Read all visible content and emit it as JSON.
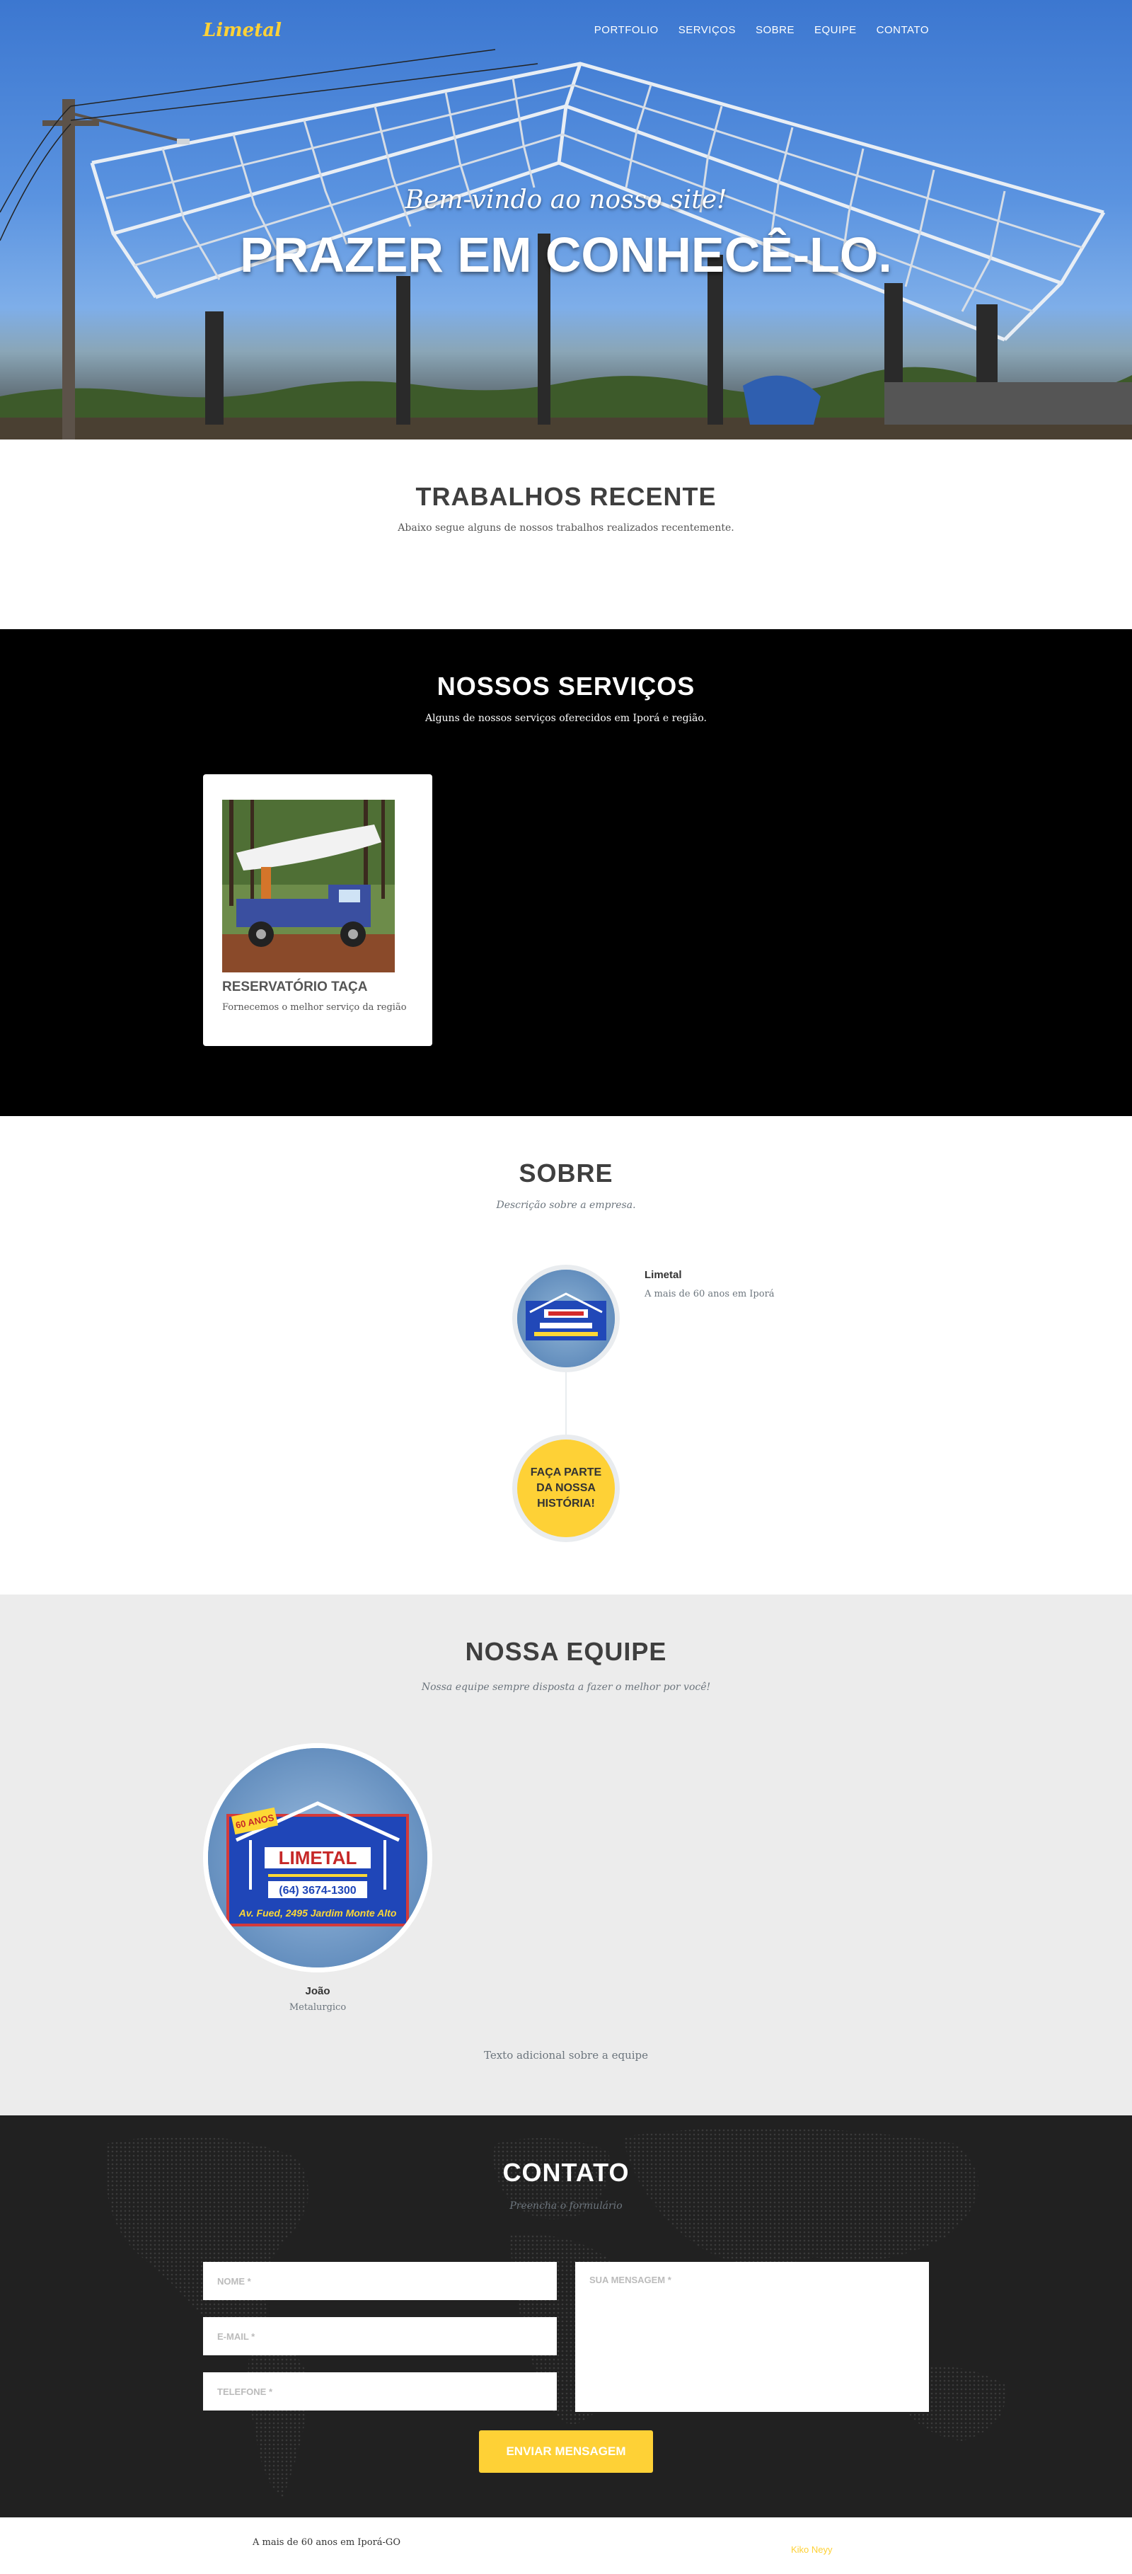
{
  "nav": {
    "brand": "Limetal",
    "items": [
      "PORTFOLIO",
      "SERVIÇOS",
      "SOBRE",
      "EQUIPE",
      "CONTATO"
    ]
  },
  "hero": {
    "subheading": "Bem-vindo ao nosso site!",
    "heading": "PRAZER EM CONHECÊ-LO."
  },
  "trabalhos": {
    "title": "TRABALHOS RECENTE",
    "subtitle": "Abaixo segue alguns de nossos trabalhos realizados recentemente."
  },
  "servicos": {
    "title": "NOSSOS SERVIÇOS",
    "subtitle": "Alguns de nossos serviços oferecidos em Iporá e região.",
    "cards": [
      {
        "title": "RESERVATÓRIO TAÇA",
        "text": "Fornecemos o melhor serviço da região"
      }
    ]
  },
  "sobre": {
    "title": "SOBRE",
    "subtitle": "Descrição sobre a empresa.",
    "timeline": [
      {
        "heading": "Limetal",
        "body": "A mais de 60 anos em Iporá"
      }
    ],
    "cta": "FAÇA PARTE DA NOSSA HISTÓRIA!"
  },
  "equipe": {
    "title": "NOSSA EQUIPE",
    "subtitle": "Nossa equipe sempre disposta a fazer o melhor por você!",
    "members": [
      {
        "name": "João",
        "role": "Metalurgico"
      }
    ],
    "extra": "Texto adicional sobre a equipe"
  },
  "logo_badge": {
    "years": "60 ANOS",
    "name": "LIMETAL",
    "phone": "(64) 3674-1300",
    "address": "Av. Fued, 2495 Jardim Monte Alto"
  },
  "contato": {
    "title": "CONTATO",
    "subtitle": "Preencha o formulário",
    "name_placeholder": "NOME *",
    "email_placeholder": "E-MAIL *",
    "phone_placeholder": "TELEFONE *",
    "message_placeholder": "SUA MENSAGEM *",
    "send_label": "ENVIAR MENSAGEM"
  },
  "footer": {
    "copyright": "A mais de 60 anos em Iporá-GO",
    "credit": "Kiko Neyy"
  },
  "colors": {
    "accent": "#fed136",
    "dark": "#212121",
    "black": "#000000",
    "light_gray": "#ececec"
  }
}
